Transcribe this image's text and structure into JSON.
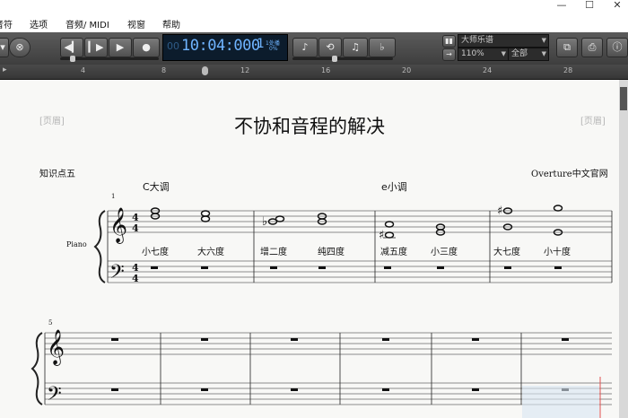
{
  "window": {
    "minimize_glyph": "—",
    "maximize_glyph": "☐",
    "close_glyph": "✕"
  },
  "menu": [
    {
      "label": "音符"
    },
    {
      "label": "选项"
    },
    {
      "label": "音频/ MIDI"
    },
    {
      "label": "视窗"
    },
    {
      "label": "帮助"
    }
  ],
  "transport": {
    "time": "10:04:000",
    "measure": "1",
    "small_label": "1处播",
    "percent": "0%"
  },
  "controls": {
    "instrument_select": "大师乐谱",
    "zoom_select": "110%",
    "view_select": "全部"
  },
  "ruler": {
    "ticks": [
      "4",
      "8",
      "12",
      "16",
      "20",
      "24",
      "28"
    ]
  },
  "score": {
    "title": "不协和音程的解决",
    "header_left": "[页眉]",
    "header_right": "[页眉]",
    "composer_left": "知识点五",
    "composer_right": "Overture中文官网",
    "key_c": "C大调",
    "key_e": "e小调",
    "instrument": "Piano",
    "measure_1": "1",
    "measure_5": "5",
    "intervals": [
      "小七度",
      "大六度",
      "增二度",
      "纯四度",
      "减五度",
      "小三度",
      "大七度",
      "小十度"
    ]
  }
}
